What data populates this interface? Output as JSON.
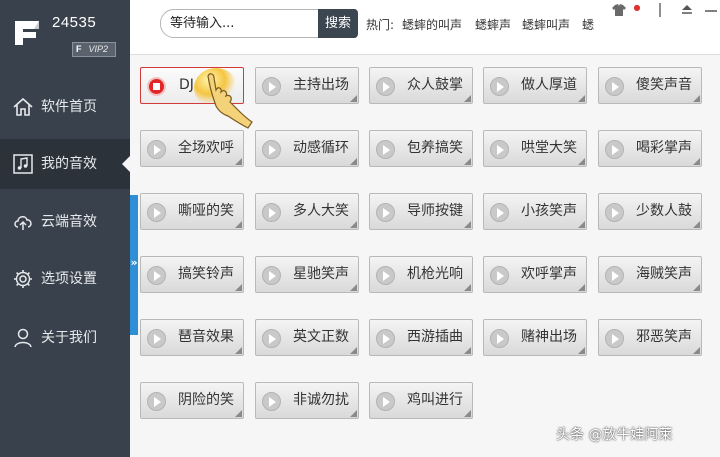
{
  "app": {
    "name": "24535",
    "vip_badge": "VIP2",
    "vip_prefix": "F"
  },
  "sidebar": {
    "items": [
      {
        "label": "软件首页",
        "icon": "home-icon",
        "active": false
      },
      {
        "label": "我的音效",
        "icon": "music-note-icon",
        "active": true
      },
      {
        "label": "云端音效",
        "icon": "cloud-upload-icon",
        "active": false
      },
      {
        "label": "选项设置",
        "icon": "gear-icon",
        "active": false
      },
      {
        "label": "关于我们",
        "icon": "user-icon",
        "active": false
      }
    ],
    "collapse_glyph": "»"
  },
  "search": {
    "placeholder": "等待输入...",
    "value": "",
    "button_label": "搜索",
    "hot_label": "热门:",
    "hot_links": [
      "蟋蟀的叫声",
      "蟋蟀声",
      "蟋蟀叫声",
      "蟋"
    ]
  },
  "window_controls": {
    "skin": "shirt-icon",
    "menu": "menu-icon",
    "minimize": "minimize-icon",
    "close": "close-icon"
  },
  "sounds": [
    {
      "label": "DJ",
      "state": "playing"
    },
    {
      "label": "主持出场"
    },
    {
      "label": "众人鼓掌"
    },
    {
      "label": "做人厚道"
    },
    {
      "label": "傻笑声音"
    },
    {
      "label": "全场欢呼"
    },
    {
      "label": "动感循环"
    },
    {
      "label": "包养搞笑"
    },
    {
      "label": "哄堂大笑"
    },
    {
      "label": "喝彩掌声"
    },
    {
      "label": "嘶哑的笑"
    },
    {
      "label": "多人大笑"
    },
    {
      "label": "导师按键"
    },
    {
      "label": "小孩笑声"
    },
    {
      "label": "少数人鼓"
    },
    {
      "label": "搞笑铃声"
    },
    {
      "label": "星驰笑声"
    },
    {
      "label": "机枪光响"
    },
    {
      "label": "欢呼掌声"
    },
    {
      "label": "海贼笑声"
    },
    {
      "label": "琶音效果"
    },
    {
      "label": "英文正数"
    },
    {
      "label": "西游插曲"
    },
    {
      "label": "赌神出场"
    },
    {
      "label": "邪恶笑声"
    },
    {
      "label": "阴险的笑"
    },
    {
      "label": "非诚勿扰"
    },
    {
      "label": "鸡叫进行"
    }
  ],
  "watermark": "头条 @放牛娃阿莱",
  "colors": {
    "sidebar_bg": "#39424c",
    "sidebar_active_bg": "#2b323a",
    "accent_strip": "#2e8ed6",
    "search_button_bg": "#3c4650",
    "playing_red": "#e02626"
  }
}
